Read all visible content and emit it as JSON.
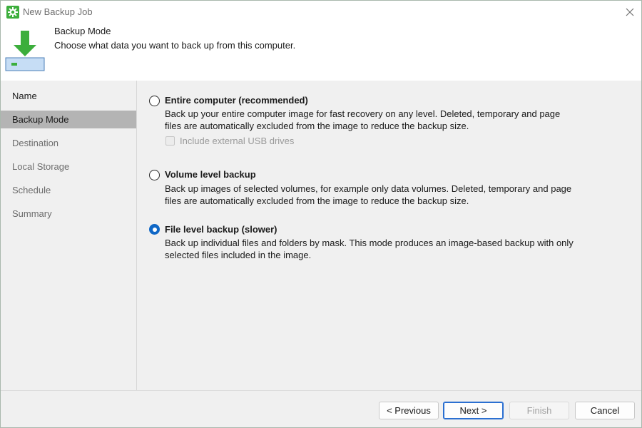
{
  "window": {
    "title": "New Backup Job",
    "icon": "gear-app-icon",
    "close_icon": "close-icon"
  },
  "header": {
    "title": "Backup Mode",
    "subtitle": "Choose what data you want to back up from this computer.",
    "icon": "download-arrow-drive-icon",
    "accent_color": "#3cae3c"
  },
  "sidebar": {
    "items": [
      {
        "label": "Name",
        "state": "completed"
      },
      {
        "label": "Backup Mode",
        "state": "active"
      },
      {
        "label": "Destination",
        "state": "pending"
      },
      {
        "label": "Local Storage",
        "state": "pending"
      },
      {
        "label": "Schedule",
        "state": "pending"
      },
      {
        "label": "Summary",
        "state": "pending"
      }
    ]
  },
  "options": {
    "entire": {
      "label": "Entire computer (recommended)",
      "desc_line1": "Back up your entire computer image for fast recovery on any level. Deleted, temporary and page",
      "desc_line2": "files are automatically excluded from the image to reduce the backup size.",
      "checked": false,
      "usb": {
        "label": "Include external USB drives",
        "checked": false,
        "enabled": false
      }
    },
    "volume": {
      "label": "Volume level backup",
      "desc_line1": "Back up images of selected volumes, for example only data volumes. Deleted, temporary and page",
      "desc_line2": "files are automatically excluded from the image to reduce the backup size.",
      "checked": false
    },
    "file": {
      "label": "File level backup (slower)",
      "desc_line1": "Back up individual files and folders by mask. This mode produces an image-based backup with only",
      "desc_line2": "selected files included in the image.",
      "checked": true
    }
  },
  "buttons": {
    "previous": "< Previous",
    "next": "Next >",
    "finish": "Finish",
    "cancel": "Cancel"
  },
  "colors": {
    "selected_radio": "#0f67c6",
    "active_nav_bg": "#b4b4b4",
    "primary_button_border": "#2a6fd1"
  }
}
